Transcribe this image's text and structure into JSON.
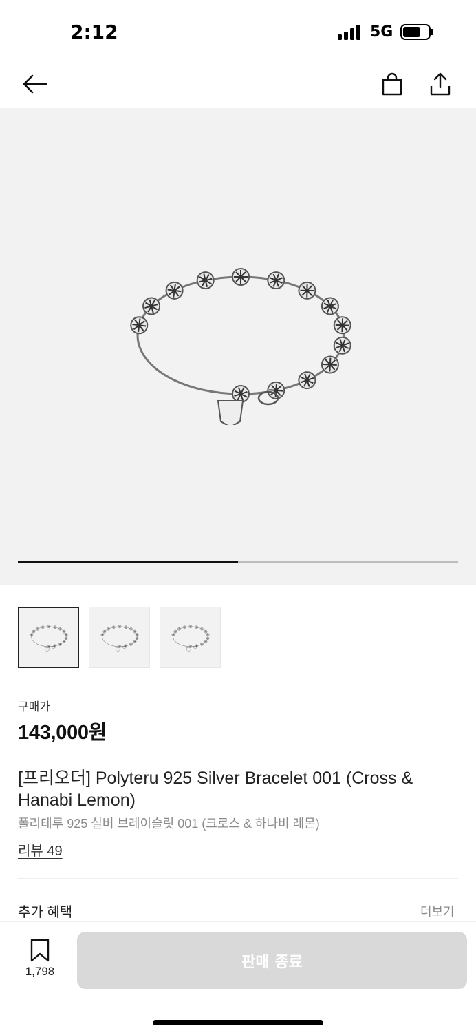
{
  "status_bar": {
    "time": "2:12",
    "network": "5G",
    "battery_percent": 70
  },
  "nav": {
    "back_icon": "arrow-left-icon",
    "cart_icon": "shopping-bag-icon",
    "share_icon": "share-icon"
  },
  "gallery": {
    "progress": 0.5,
    "thumbnail_count": 3,
    "selected_index": 0
  },
  "product": {
    "price_label": "구매가",
    "price": "143,000원",
    "title": "[프리오더] Polyteru 925 Silver Bracelet 001 (Cross & Hanabi Lemon)",
    "subtitle": "폴리테루 925 실버 브레이슬릿 001 (크로스 & 하나비 레몬)",
    "review_link": "리뷰 49"
  },
  "benefits": {
    "label": "추가 혜택",
    "more": "더보기"
  },
  "bottom": {
    "bookmark_icon": "bookmark-icon",
    "bookmark_count": "1,798",
    "cta_label": "판매 종료",
    "cta_color": "#d9d9d9"
  }
}
